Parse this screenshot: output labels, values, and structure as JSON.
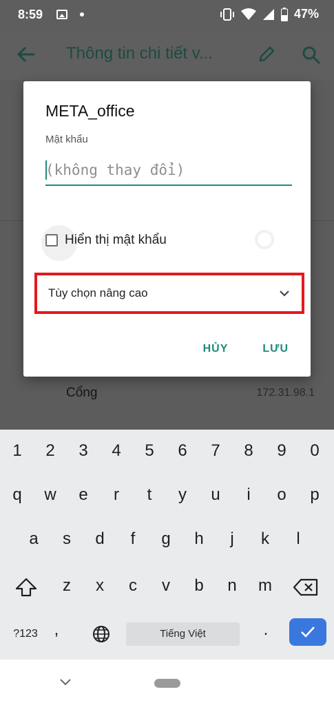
{
  "status_bar": {
    "time": "8:59",
    "battery_percent": "47%",
    "icons": [
      "image-icon",
      "dot-icon",
      "vibrate-icon",
      "wifi-icon",
      "signal-icon",
      "battery-icon"
    ]
  },
  "app_bar": {
    "title": "Thông tin chi tiết v...",
    "icons": [
      "back-arrow-icon",
      "edit-pencil-icon",
      "search-icon"
    ]
  },
  "background": {
    "row_label": "Cổng",
    "row_value": "172.31.98.1"
  },
  "dialog": {
    "title": "META_office",
    "password_label": "Mật khẩu",
    "password_placeholder": "(không thay đổi)",
    "show_password_label": "Hiển thị mật khẩu",
    "advanced_options_label": "Tùy chọn nâng cao",
    "cancel_label": "HỦY",
    "save_label": "LƯU",
    "highlight_color": "#e4181f",
    "accent_color": "#1f8a78"
  },
  "keyboard": {
    "number_row": [
      "1",
      "2",
      "3",
      "4",
      "5",
      "6",
      "7",
      "8",
      "9",
      "0"
    ],
    "row1": [
      "q",
      "w",
      "e",
      "r",
      "t",
      "y",
      "u",
      "i",
      "o",
      "p"
    ],
    "row2": [
      "a",
      "s",
      "d",
      "f",
      "g",
      "h",
      "j",
      "k",
      "l"
    ],
    "row3": [
      "z",
      "x",
      "c",
      "v",
      "b",
      "n",
      "m"
    ],
    "symbols_label": "?123",
    "space_label": "Tiếng Việt",
    "comma": ",",
    "period": ".",
    "enter_color": "#3a78e0"
  }
}
